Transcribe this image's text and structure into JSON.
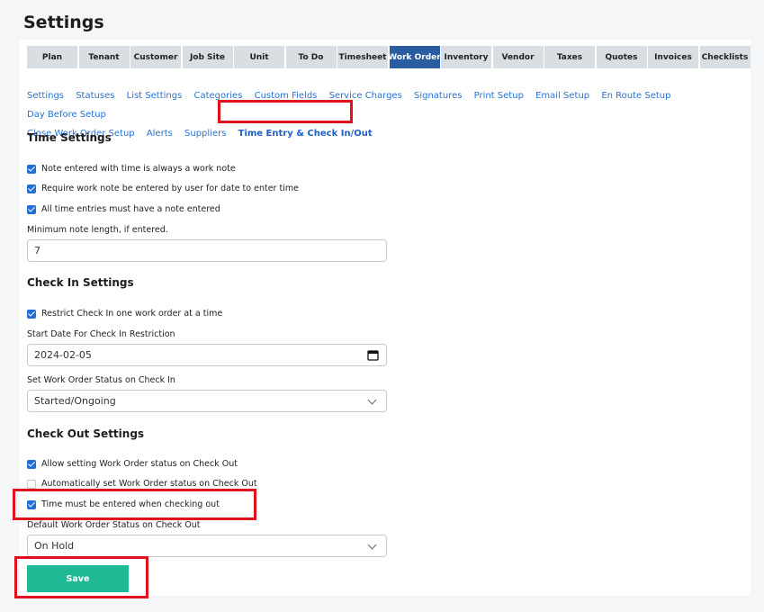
{
  "page_title": "Settings",
  "tabs": [
    "Plan",
    "Tenant",
    "Customer",
    "Job Site",
    "Unit",
    "To Do",
    "Timesheet",
    "Work Order",
    "Inventory",
    "Vendor",
    "Taxes",
    "Quotes",
    "Invoices",
    "Checklists"
  ],
  "active_tab": "Work Order",
  "subnav_row1": [
    "Settings",
    "Statuses",
    "List Settings",
    "Categories",
    "Custom Fields",
    "Service Charges",
    "Signatures",
    "Print Setup",
    "Email Setup",
    "En Route Setup",
    "Day Before Setup"
  ],
  "subnav_row2": [
    "Close Work Order Setup",
    "Alerts",
    "Suppliers"
  ],
  "subnav_active": "Time Entry & Check In/Out",
  "time_settings": {
    "title": "Time Settings",
    "check1": "Note entered with time is always a work note",
    "check2": "Require work note be entered by user for date to enter time",
    "check3": "All time entries must have a note entered",
    "min_note_label": "Minimum note length, if entered.",
    "min_note_value": "7"
  },
  "check_in": {
    "title": "Check In Settings",
    "check1": "Restrict Check In one work order at a time",
    "start_date_label": "Start Date For Check In Restriction",
    "start_date_value": "2024-02-05",
    "status_label": "Set Work Order Status on Check In",
    "status_value": "Started/Ongoing"
  },
  "check_out": {
    "title": "Check Out Settings",
    "check1": "Allow setting Work Order status on Check Out",
    "check2": "Automatically set Work Order status on Check Out",
    "check3": "Time must be entered when checking out",
    "default_label": "Default Work Order Status on Check Out",
    "default_value": "On Hold"
  },
  "save_label": "Save",
  "colors": {
    "accent": "#2a5d9f",
    "save": "#20b995",
    "highlight": "#e0101f",
    "link": "#2a72d0"
  }
}
